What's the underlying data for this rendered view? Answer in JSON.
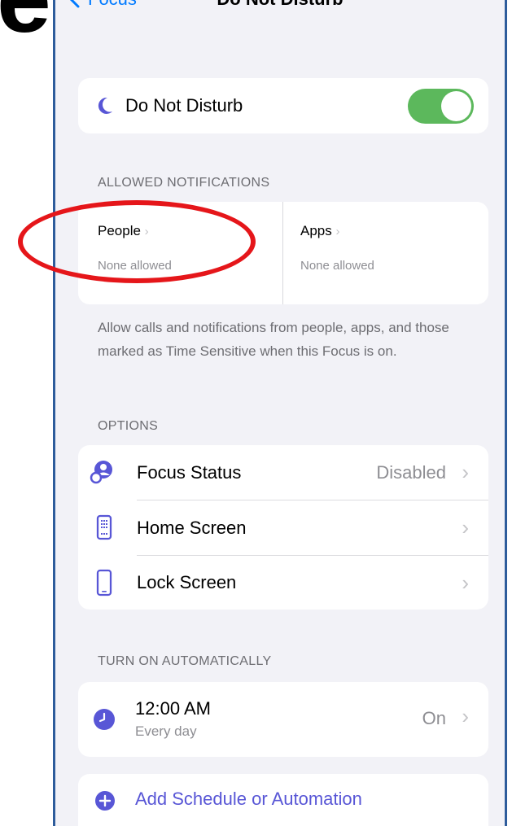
{
  "background_letter": "e",
  "nav": {
    "back_label": "Focus",
    "title": "Do Not Disturb"
  },
  "dnd_row": {
    "label": "Do Not Disturb",
    "toggle_on": true
  },
  "allowed": {
    "header": "ALLOWED NOTIFICATIONS",
    "people": {
      "label": "People",
      "value": "None allowed"
    },
    "apps": {
      "label": "Apps",
      "value": "None allowed"
    },
    "footer": "Allow calls and notifications from people, apps, and those marked as Time Sensitive when this Focus is on."
  },
  "options": {
    "header": "OPTIONS",
    "items": [
      {
        "label": "Focus Status",
        "detail": "Disabled",
        "icon": "focus-status-icon"
      },
      {
        "label": "Home Screen",
        "detail": "",
        "icon": "home-screen-icon"
      },
      {
        "label": "Lock Screen",
        "detail": "",
        "icon": "lock-screen-icon"
      }
    ]
  },
  "automatic": {
    "header": "TURN ON AUTOMATICALLY",
    "schedule": {
      "time": "12:00 AM",
      "repeat": "Every day",
      "state": "On"
    },
    "add_label": "Add Schedule or Automation"
  },
  "colors": {
    "accent": "#5856d6",
    "toggle_green": "#5cb85c",
    "link_blue": "#007aff",
    "annotation_red": "#e5161a"
  }
}
